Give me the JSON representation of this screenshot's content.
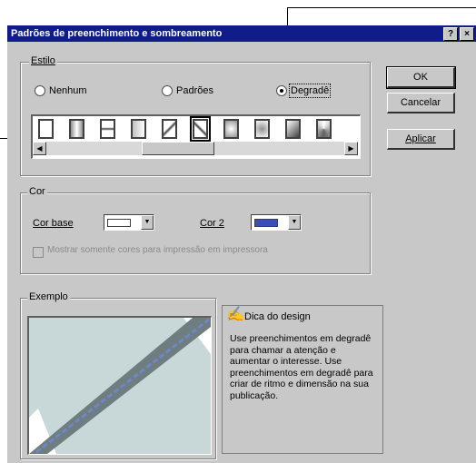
{
  "window": {
    "title": "Padrões de preenchimento e sombreamento",
    "help_label": "?",
    "close_label": "×"
  },
  "estilo": {
    "legend": "Estilo",
    "options": [
      {
        "label": "Nenhum",
        "selected": false
      },
      {
        "label": "Padrões",
        "selected": false
      },
      {
        "label": "Degradê",
        "selected": true
      }
    ],
    "swatch_count": 10,
    "selected_swatch": 5
  },
  "buttons": {
    "ok": "OK",
    "cancel": "Cancelar",
    "apply": "Aplicar"
  },
  "cor": {
    "legend": "Cor",
    "base_label": "Cor base",
    "base_color": "#ffffff",
    "cor2_label": "Cor 2",
    "cor2_color": "#3a4fb8",
    "checkbox_label": "Mostrar somente cores para impressão em impressora",
    "checkbox_checked": false
  },
  "example": {
    "legend": "Exemplo",
    "band_color": "#6e7e80",
    "line_color": "#6f86c8",
    "bg_color": "#c8d8d8"
  },
  "tip": {
    "title": "Dica do design",
    "text": "Use preenchimentos em degradê para chamar a atenção e aumentar o interesse. Use preenchimentos em degradê para criar de ritmo e dimensão na sua publicação."
  },
  "colors": {
    "titlebar": "#0f1c8a",
    "dialog_bg": "#c8c8c8"
  }
}
